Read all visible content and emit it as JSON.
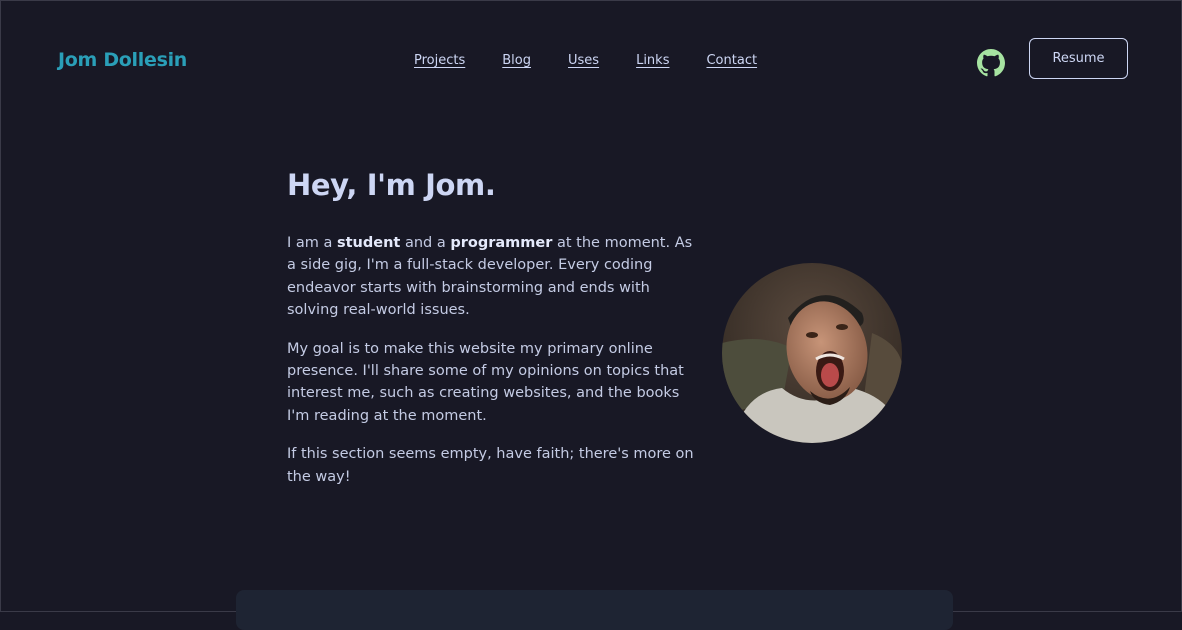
{
  "header": {
    "brand": "Jom Dollesin",
    "nav": [
      "Projects",
      "Blog",
      "Uses",
      "Links",
      "Contact"
    ],
    "resume_label": "Resume",
    "github_icon": "github-icon"
  },
  "hero": {
    "title": "Hey, I'm Jom.",
    "p1": {
      "a": "I am a ",
      "b": "student",
      "c": " and a ",
      "d": "programmer",
      "e": " at the moment. As a side gig, I'm a full-stack developer. Every coding endeavor starts with brainstorming and ends with solving real-world issues."
    },
    "p2": "My goal is to make this website my primary online presence. I'll share some of my opinions on topics that interest me, such as creating websites, and the books I'm reading at the moment.",
    "p3": "If this section seems empty, have faith; there's more on the way!"
  },
  "colors": {
    "background": "#181825",
    "text": "#cdd6f4",
    "brand": "#2a9fb8",
    "github": "#a6e3a1",
    "card": "#1e2433"
  }
}
